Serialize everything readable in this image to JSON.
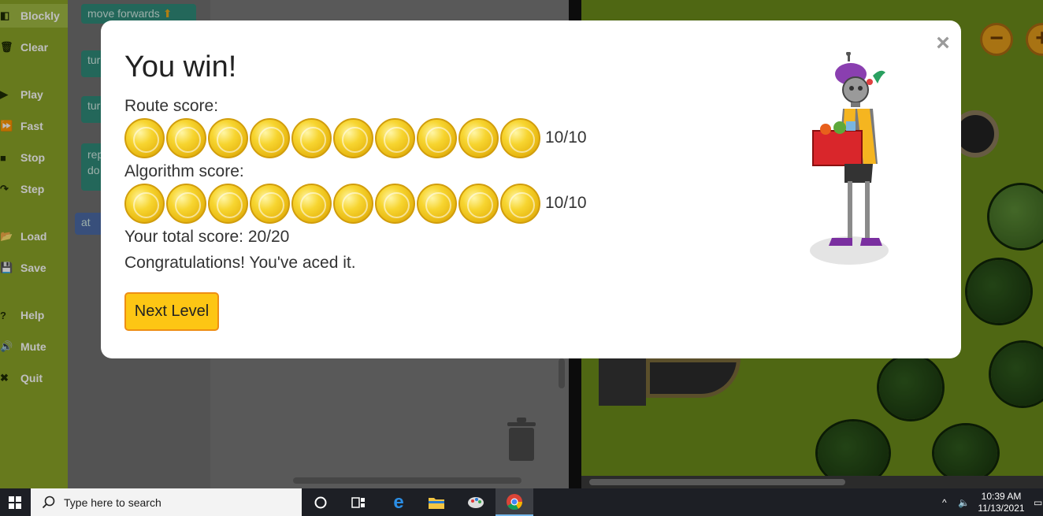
{
  "sidebar": {
    "items": [
      {
        "label": "Blockly",
        "icon": "blockly-icon",
        "glyph": "◧"
      },
      {
        "label": "Clear",
        "icon": "trash-icon",
        "glyph": "🗑"
      },
      {
        "label": "Play",
        "icon": "play-icon",
        "glyph": "▶"
      },
      {
        "label": "Fast",
        "icon": "fast-forward-icon",
        "glyph": "⏩"
      },
      {
        "label": "Stop",
        "icon": "stop-icon",
        "glyph": "■"
      },
      {
        "label": "Step",
        "icon": "step-icon",
        "glyph": "↷"
      },
      {
        "label": "Load",
        "icon": "folder-icon",
        "glyph": "📂"
      },
      {
        "label": "Save",
        "icon": "save-icon",
        "glyph": "💾"
      },
      {
        "label": "Help",
        "icon": "help-icon",
        "glyph": "?"
      },
      {
        "label": "Mute",
        "icon": "speaker-icon",
        "glyph": "🔊"
      },
      {
        "label": "Quit",
        "icon": "close-icon",
        "glyph": "✖"
      }
    ]
  },
  "palette": {
    "blocks": [
      "move forwards",
      "tur",
      "tur",
      "rep",
      "do",
      "at"
    ]
  },
  "modal": {
    "title": "You win!",
    "route_label": "Route score:",
    "route_score": "10/10",
    "route_coins": 10,
    "algorithm_label": "Algorithm score:",
    "algorithm_score": "10/10",
    "algorithm_coins": 10,
    "total": "Your total score: 20/20",
    "message": "Congratulations! You've aced it.",
    "next_button": "Next Level",
    "close_glyph": "×"
  },
  "map": {
    "zoom_out": "−",
    "zoom_in": "+"
  },
  "taskbar": {
    "search_placeholder": "Type here to search",
    "time": "10:39 AM",
    "date": "11/13/2021"
  },
  "colors": {
    "sidebar": "#8aa327",
    "accent_button": "#fdc614",
    "accent_border": "#ee8e14"
  }
}
